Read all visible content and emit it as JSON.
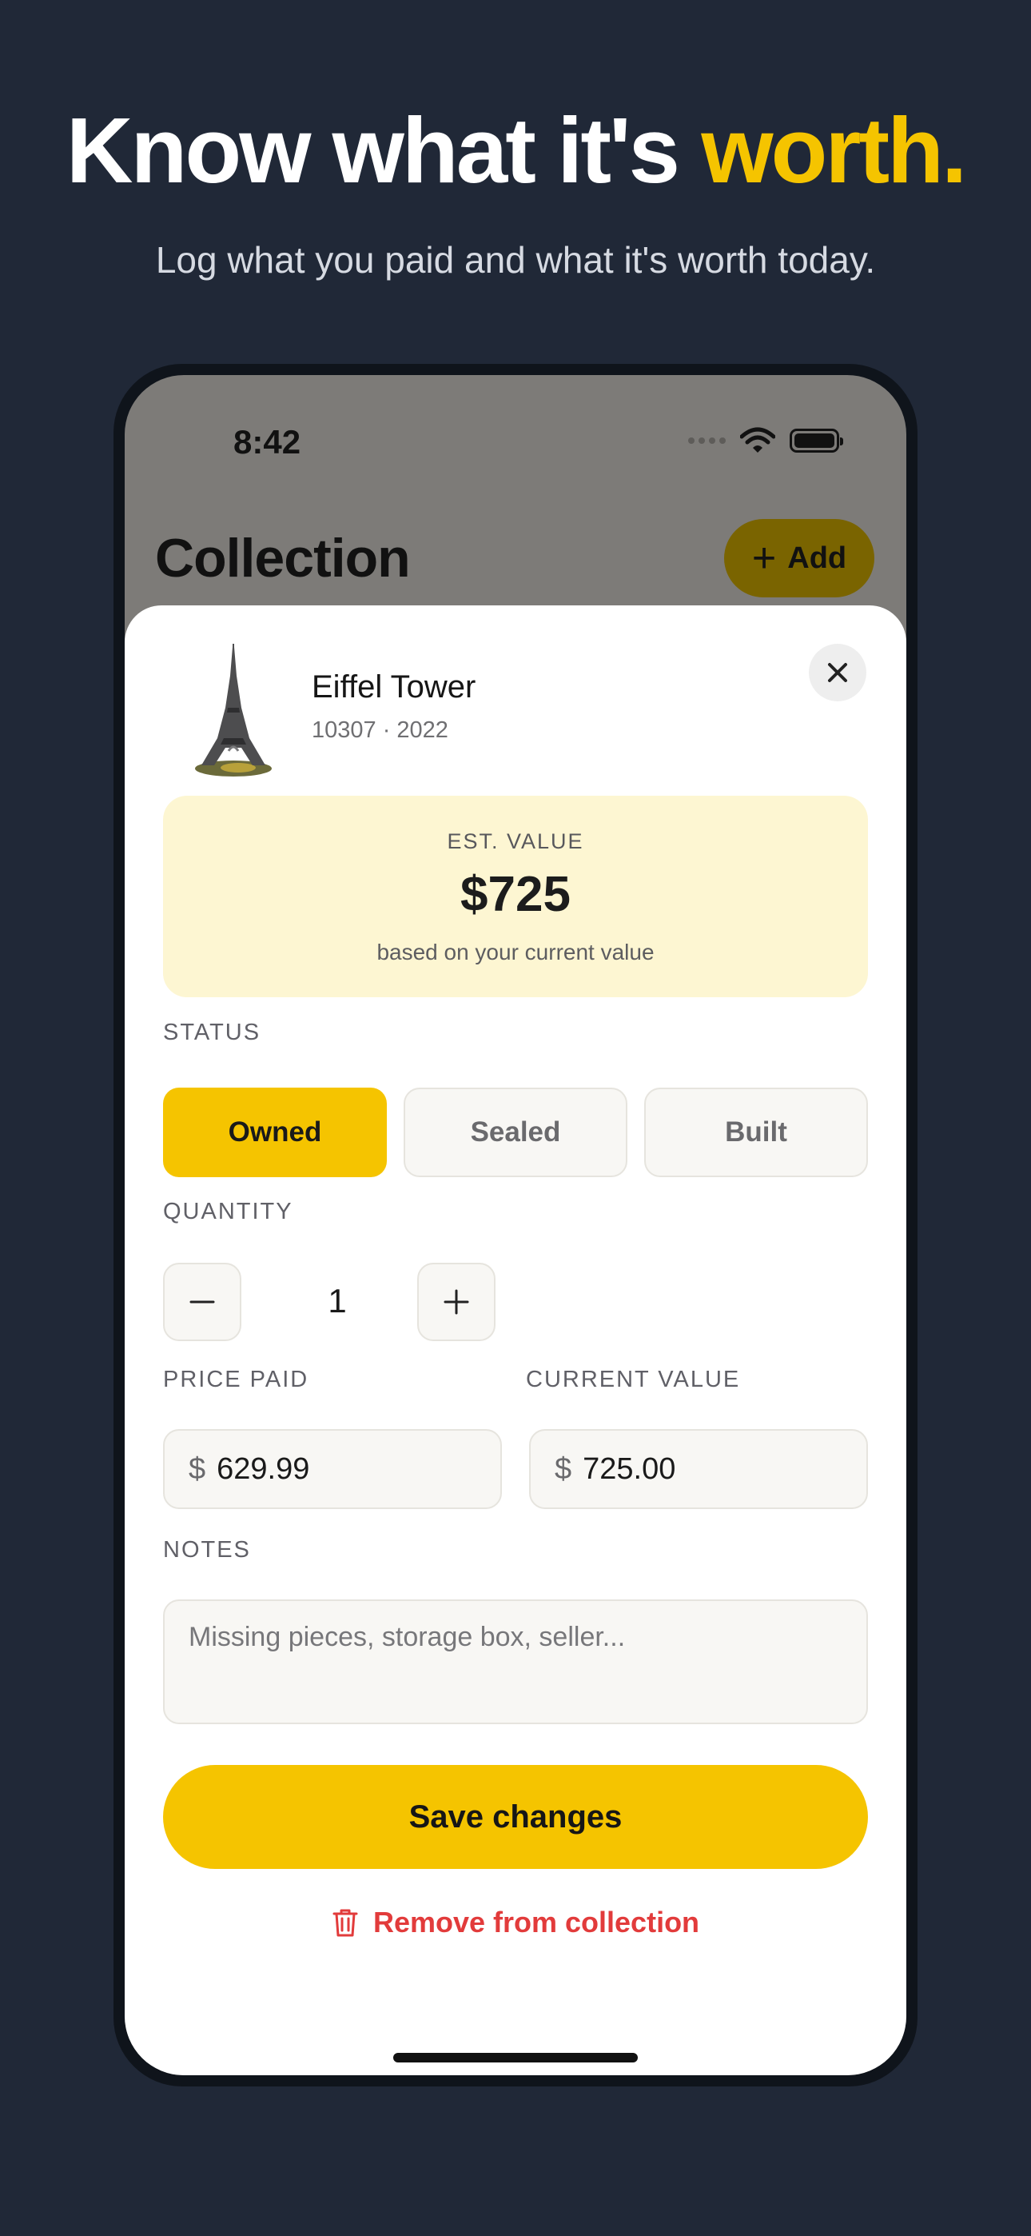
{
  "marketing": {
    "headline_main": "Know what it's ",
    "headline_accent": "worth.",
    "subline": "Log what you paid and what it's worth today."
  },
  "status_bar": {
    "time": "8:42"
  },
  "background_screen": {
    "title": "Collection",
    "add_label": "Add"
  },
  "item": {
    "name": "Eiffel Tower",
    "meta": "10307 · 2022"
  },
  "estimate": {
    "label": "EST. VALUE",
    "amount": "$725",
    "note": "based on your current value"
  },
  "status": {
    "label": "STATUS",
    "options": [
      "Owned",
      "Sealed",
      "Built"
    ],
    "selected": "Owned"
  },
  "quantity": {
    "label": "QUANTITY",
    "value": "1"
  },
  "price_paid": {
    "label": "PRICE PAID",
    "currency": "$",
    "value": "629.99"
  },
  "current_value": {
    "label": "CURRENT VALUE",
    "currency": "$",
    "value": "725.00"
  },
  "notes": {
    "label": "NOTES",
    "placeholder": "Missing pieces, storage box, seller..."
  },
  "actions": {
    "save_label": "Save changes",
    "remove_label": "Remove from collection"
  },
  "colors": {
    "accent": "#f5c400",
    "background": "#202837",
    "danger": "#e23b3b",
    "value_card": "#fdf6d2"
  },
  "icons": [
    "wifi-icon",
    "battery-icon",
    "plus-icon",
    "close-icon",
    "minus-icon",
    "trash-icon"
  ]
}
